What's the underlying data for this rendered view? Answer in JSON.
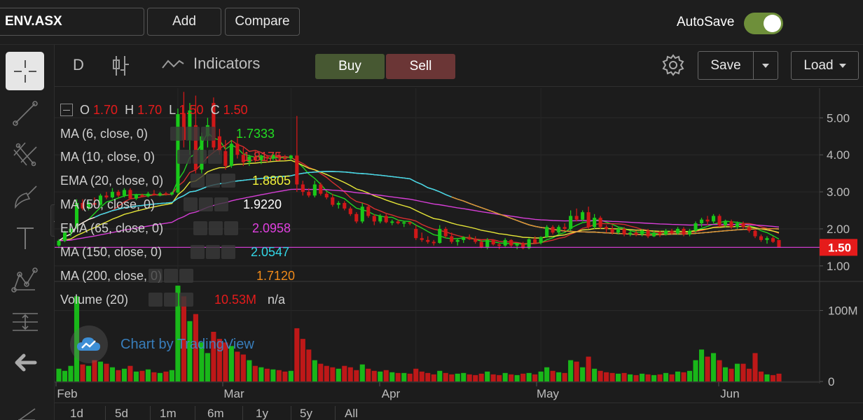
{
  "topbar": {
    "symbol": "ENV.ASX",
    "add_label": "Add",
    "compare_label": "Compare",
    "autosave_label": "AutoSave",
    "autosave_on": true,
    "toggle_color": "#6e8f3a"
  },
  "toolbar": {
    "interval": "D",
    "indicators_label": "Indicators",
    "buy_label": "Buy",
    "sell_label": "Sell",
    "save_label": "Save",
    "load_label": "Load",
    "buy_color": "#475832",
    "sell_color": "#6b3636"
  },
  "left_tools": [
    "crosshair-icon",
    "trend-line-icon",
    "fib-tools-icon",
    "brush-icon",
    "text-icon",
    "pattern-icon",
    "measure-icon",
    "back-arrow-icon"
  ],
  "legend": {
    "ohlc": {
      "o_label": "O",
      "o": "1.70",
      "h_label": "H",
      "h": "1.70",
      "l_label": "L",
      "l": "1.50",
      "c_label": "C",
      "c": "1.50"
    },
    "indicators": [
      {
        "label": "MA (6, close, 0)",
        "value": "1.7333",
        "color": "#22dd22"
      },
      {
        "label": "MA (10, close, 0)",
        "value": "1.8175",
        "color": "#e03030"
      },
      {
        "label": "EMA (20, close, 0)",
        "value": "1.8805",
        "color": "#f2f23a"
      },
      {
        "label": "MA (50, close, 0)",
        "value": "1.9220",
        "color": "#ffffff"
      },
      {
        "label": "EMA (65, close, 0)",
        "value": "2.0958",
        "color": "#e040e0"
      },
      {
        "label": "MA (150, close, 0)",
        "value": "2.0547",
        "color": "#33d6e6"
      },
      {
        "label": "MA (200, close, 0)",
        "value": "1.7120",
        "color": "#f08a1a"
      }
    ],
    "volume": {
      "label": "Volume (20)",
      "value": "10.53M",
      "ma": "n/a"
    }
  },
  "price_axis": {
    "ticks": [
      "5.00",
      "4.00",
      "3.00",
      "2.00",
      "1.00"
    ],
    "last_price": "1.50",
    "last_price_color": "#e51b1b"
  },
  "volume_axis": {
    "ticks": [
      "100M",
      "0"
    ]
  },
  "time_axis": {
    "labels": [
      "Feb",
      "Mar",
      "Apr",
      "May",
      "Jun"
    ]
  },
  "watermark": "Chart by TradingView",
  "ranges": [
    "1d",
    "5d",
    "1m",
    "6m",
    "1y",
    "5y",
    "All"
  ],
  "chart_data": {
    "type": "candlestick",
    "symbol": "ENV.ASX",
    "interval": "D",
    "y_range": [
      0.6,
      5.8
    ],
    "volume_range_millions": [
      0,
      140
    ],
    "candles": [
      {
        "o": 1.55,
        "h": 1.72,
        "l": 1.48,
        "c": 1.68,
        "v": 18
      },
      {
        "o": 1.68,
        "h": 1.95,
        "l": 1.64,
        "c": 1.9,
        "v": 15
      },
      {
        "o": 1.9,
        "h": 2.05,
        "l": 1.8,
        "c": 2.0,
        "v": 22
      },
      {
        "o": 2.05,
        "h": 2.8,
        "l": 2.0,
        "c": 2.7,
        "v": 120
      },
      {
        "o": 2.7,
        "h": 2.8,
        "l": 2.5,
        "c": 2.55,
        "v": 24
      },
      {
        "o": 2.55,
        "h": 2.75,
        "l": 2.5,
        "c": 2.7,
        "v": 22
      },
      {
        "o": 2.7,
        "h": 2.85,
        "l": 2.6,
        "c": 2.65,
        "v": 30
      },
      {
        "o": 2.65,
        "h": 2.95,
        "l": 2.62,
        "c": 2.9,
        "v": 28
      },
      {
        "o": 2.9,
        "h": 3.0,
        "l": 2.8,
        "c": 2.85,
        "v": 25
      },
      {
        "o": 2.85,
        "h": 3.1,
        "l": 2.82,
        "c": 3.0,
        "v": 20
      },
      {
        "o": 3.0,
        "h": 3.05,
        "l": 2.85,
        "c": 2.9,
        "v": 16
      },
      {
        "o": 2.9,
        "h": 3.1,
        "l": 2.85,
        "c": 3.05,
        "v": 18
      },
      {
        "o": 3.05,
        "h": 3.1,
        "l": 2.8,
        "c": 2.82,
        "v": 22
      },
      {
        "o": 2.82,
        "h": 2.95,
        "l": 2.78,
        "c": 2.92,
        "v": 14
      },
      {
        "o": 2.92,
        "h": 2.95,
        "l": 2.85,
        "c": 2.88,
        "v": 15
      },
      {
        "o": 2.88,
        "h": 3.0,
        "l": 2.85,
        "c": 2.95,
        "v": 17
      },
      {
        "o": 2.95,
        "h": 3.05,
        "l": 2.9,
        "c": 2.92,
        "v": 13
      },
      {
        "o": 2.92,
        "h": 3.0,
        "l": 2.88,
        "c": 2.96,
        "v": 12
      },
      {
        "o": 2.96,
        "h": 3.0,
        "l": 2.9,
        "c": 2.93,
        "v": 14
      },
      {
        "o": 2.93,
        "h": 3.0,
        "l": 2.9,
        "c": 2.98,
        "v": 16
      },
      {
        "o": 2.98,
        "h": 5.25,
        "l": 2.95,
        "c": 5.1,
        "v": 135
      },
      {
        "o": 5.1,
        "h": 5.7,
        "l": 4.2,
        "c": 4.4,
        "v": 120
      },
      {
        "o": 4.4,
        "h": 5.4,
        "l": 4.0,
        "c": 5.2,
        "v": 85
      },
      {
        "o": 4.8,
        "h": 5.6,
        "l": 3.5,
        "c": 3.6,
        "v": 95
      },
      {
        "o": 3.6,
        "h": 4.6,
        "l": 3.5,
        "c": 4.5,
        "v": 55
      },
      {
        "o": 4.5,
        "h": 5.0,
        "l": 4.2,
        "c": 4.8,
        "v": 40
      },
      {
        "o": 5.4,
        "h": 5.55,
        "l": 4.1,
        "c": 4.2,
        "v": 70
      },
      {
        "o": 4.5,
        "h": 4.7,
        "l": 4.0,
        "c": 4.1,
        "v": 60
      },
      {
        "o": 4.1,
        "h": 4.4,
        "l": 3.6,
        "c": 3.7,
        "v": 55
      },
      {
        "o": 3.7,
        "h": 4.4,
        "l": 3.65,
        "c": 4.3,
        "v": 50
      },
      {
        "o": 4.3,
        "h": 4.5,
        "l": 3.9,
        "c": 4.0,
        "v": 42
      },
      {
        "o": 4.0,
        "h": 4.2,
        "l": 3.7,
        "c": 3.8,
        "v": 38
      },
      {
        "o": 3.8,
        "h": 4.0,
        "l": 3.7,
        "c": 3.95,
        "v": 30
      },
      {
        "o": 3.95,
        "h": 4.1,
        "l": 3.8,
        "c": 3.85,
        "v": 22
      },
      {
        "o": 3.85,
        "h": 4.0,
        "l": 3.75,
        "c": 3.95,
        "v": 20
      },
      {
        "o": 3.95,
        "h": 4.0,
        "l": 3.8,
        "c": 3.9,
        "v": 18
      },
      {
        "o": 3.9,
        "h": 4.05,
        "l": 3.85,
        "c": 4.0,
        "v": 17
      },
      {
        "o": 4.0,
        "h": 4.05,
        "l": 3.85,
        "c": 3.92,
        "v": 16
      },
      {
        "o": 3.92,
        "h": 4.0,
        "l": 3.85,
        "c": 3.9,
        "v": 14
      },
      {
        "o": 3.9,
        "h": 4.0,
        "l": 3.85,
        "c": 3.98,
        "v": 15
      },
      {
        "o": 3.98,
        "h": 5.05,
        "l": 3.0,
        "c": 3.2,
        "v": 75
      },
      {
        "o": 3.2,
        "h": 3.3,
        "l": 2.9,
        "c": 3.0,
        "v": 60
      },
      {
        "o": 3.0,
        "h": 3.1,
        "l": 2.85,
        "c": 2.9,
        "v": 45
      },
      {
        "o": 2.9,
        "h": 3.3,
        "l": 2.85,
        "c": 3.2,
        "v": 30
      },
      {
        "o": 3.2,
        "h": 3.25,
        "l": 2.9,
        "c": 2.95,
        "v": 25
      },
      {
        "o": 2.95,
        "h": 3.0,
        "l": 2.8,
        "c": 2.85,
        "v": 22
      },
      {
        "o": 2.85,
        "h": 2.95,
        "l": 2.6,
        "c": 2.65,
        "v": 20
      },
      {
        "o": 2.65,
        "h": 2.75,
        "l": 2.55,
        "c": 2.7,
        "v": 18
      },
      {
        "o": 2.7,
        "h": 2.75,
        "l": 2.5,
        "c": 2.55,
        "v": 22
      },
      {
        "o": 2.55,
        "h": 2.6,
        "l": 2.35,
        "c": 2.4,
        "v": 20
      },
      {
        "o": 2.4,
        "h": 2.45,
        "l": 2.15,
        "c": 2.2,
        "v": 16
      },
      {
        "o": 2.2,
        "h": 2.7,
        "l": 2.15,
        "c": 2.6,
        "v": 24
      },
      {
        "o": 2.6,
        "h": 2.65,
        "l": 2.3,
        "c": 2.35,
        "v": 18
      },
      {
        "o": 2.35,
        "h": 2.4,
        "l": 2.1,
        "c": 2.2,
        "v": 15
      },
      {
        "o": 2.2,
        "h": 2.4,
        "l": 2.15,
        "c": 2.35,
        "v": 14
      },
      {
        "o": 2.35,
        "h": 2.4,
        "l": 2.15,
        "c": 2.18,
        "v": 16
      },
      {
        "o": 2.18,
        "h": 2.25,
        "l": 2.1,
        "c": 2.2,
        "v": 13
      },
      {
        "o": 2.2,
        "h": 2.25,
        "l": 2.12,
        "c": 2.15,
        "v": 12
      },
      {
        "o": 2.15,
        "h": 2.2,
        "l": 2.05,
        "c": 2.18,
        "v": 12
      },
      {
        "o": 2.18,
        "h": 2.2,
        "l": 2.1,
        "c": 2.15,
        "v": 11
      },
      {
        "o": 2.0,
        "h": 2.1,
        "l": 1.7,
        "c": 1.75,
        "v": 18
      },
      {
        "o": 1.75,
        "h": 1.9,
        "l": 1.65,
        "c": 1.7,
        "v": 14
      },
      {
        "o": 1.7,
        "h": 1.8,
        "l": 1.6,
        "c": 1.65,
        "v": 12
      },
      {
        "o": 1.65,
        "h": 1.7,
        "l": 1.55,
        "c": 1.62,
        "v": 10
      },
      {
        "o": 1.62,
        "h": 2.1,
        "l": 1.6,
        "c": 2.0,
        "v": 15
      },
      {
        "o": 2.0,
        "h": 2.05,
        "l": 1.75,
        "c": 1.8,
        "v": 12
      },
      {
        "o": 1.8,
        "h": 1.9,
        "l": 1.6,
        "c": 1.65,
        "v": 10
      },
      {
        "o": 1.65,
        "h": 1.75,
        "l": 1.55,
        "c": 1.7,
        "v": 11
      },
      {
        "o": 1.7,
        "h": 1.8,
        "l": 1.62,
        "c": 1.78,
        "v": 12
      },
      {
        "o": 1.78,
        "h": 1.85,
        "l": 1.7,
        "c": 1.72,
        "v": 10
      },
      {
        "o": 1.72,
        "h": 1.8,
        "l": 1.6,
        "c": 1.65,
        "v": 9
      },
      {
        "o": 1.65,
        "h": 1.7,
        "l": 1.48,
        "c": 1.5,
        "v": 11
      },
      {
        "o": 1.5,
        "h": 1.75,
        "l": 1.45,
        "c": 1.7,
        "v": 14
      },
      {
        "o": 1.7,
        "h": 1.72,
        "l": 1.55,
        "c": 1.58,
        "v": 10
      },
      {
        "o": 1.58,
        "h": 1.62,
        "l": 1.45,
        "c": 1.55,
        "v": 9
      },
      {
        "o": 1.55,
        "h": 1.75,
        "l": 1.52,
        "c": 1.7,
        "v": 12
      },
      {
        "o": 1.7,
        "h": 1.72,
        "l": 1.5,
        "c": 1.55,
        "v": 10
      },
      {
        "o": 1.55,
        "h": 1.62,
        "l": 1.45,
        "c": 1.6,
        "v": 9
      },
      {
        "o": 1.6,
        "h": 1.65,
        "l": 1.45,
        "c": 1.48,
        "v": 11
      },
      {
        "o": 1.48,
        "h": 1.75,
        "l": 1.45,
        "c": 1.72,
        "v": 12
      },
      {
        "o": 1.72,
        "h": 1.8,
        "l": 1.6,
        "c": 1.62,
        "v": 10
      },
      {
        "o": 1.62,
        "h": 1.8,
        "l": 1.58,
        "c": 1.78,
        "v": 14
      },
      {
        "o": 1.78,
        "h": 2.1,
        "l": 1.75,
        "c": 2.05,
        "v": 20
      },
      {
        "o": 2.05,
        "h": 2.1,
        "l": 1.85,
        "c": 1.9,
        "v": 15
      },
      {
        "o": 1.9,
        "h": 2.1,
        "l": 1.85,
        "c": 2.05,
        "v": 13
      },
      {
        "o": 2.05,
        "h": 2.15,
        "l": 1.95,
        "c": 2.0,
        "v": 12
      },
      {
        "o": 2.0,
        "h": 2.5,
        "l": 1.95,
        "c": 2.35,
        "v": 30
      },
      {
        "o": 2.35,
        "h": 2.55,
        "l": 2.2,
        "c": 2.25,
        "v": 28
      },
      {
        "o": 2.25,
        "h": 2.5,
        "l": 2.2,
        "c": 2.45,
        "v": 20
      },
      {
        "o": 2.45,
        "h": 2.6,
        "l": 2.0,
        "c": 2.05,
        "v": 35
      },
      {
        "o": 2.05,
        "h": 2.4,
        "l": 2.0,
        "c": 2.3,
        "v": 18
      },
      {
        "o": 2.3,
        "h": 2.35,
        "l": 2.0,
        "c": 2.05,
        "v": 15
      },
      {
        "o": 2.05,
        "h": 2.1,
        "l": 1.9,
        "c": 2.0,
        "v": 13
      },
      {
        "o": 2.0,
        "h": 2.1,
        "l": 1.85,
        "c": 1.9,
        "v": 12
      },
      {
        "o": 1.9,
        "h": 2.05,
        "l": 1.85,
        "c": 2.0,
        "v": 11
      },
      {
        "o": 2.0,
        "h": 2.05,
        "l": 1.8,
        "c": 1.85,
        "v": 12
      },
      {
        "o": 1.85,
        "h": 1.95,
        "l": 1.8,
        "c": 1.9,
        "v": 10
      },
      {
        "o": 1.9,
        "h": 1.95,
        "l": 1.8,
        "c": 1.85,
        "v": 9
      },
      {
        "o": 1.85,
        "h": 2.0,
        "l": 1.8,
        "c": 1.95,
        "v": 11
      },
      {
        "o": 1.95,
        "h": 2.0,
        "l": 1.75,
        "c": 1.8,
        "v": 10
      },
      {
        "o": 1.8,
        "h": 1.95,
        "l": 1.78,
        "c": 1.9,
        "v": 9
      },
      {
        "o": 1.9,
        "h": 1.95,
        "l": 1.78,
        "c": 1.85,
        "v": 10
      },
      {
        "o": 1.85,
        "h": 2.0,
        "l": 1.82,
        "c": 1.95,
        "v": 12
      },
      {
        "o": 1.95,
        "h": 2.0,
        "l": 1.85,
        "c": 1.88,
        "v": 10
      },
      {
        "o": 1.88,
        "h": 2.05,
        "l": 1.85,
        "c": 2.0,
        "v": 14
      },
      {
        "o": 2.0,
        "h": 2.05,
        "l": 1.8,
        "c": 1.85,
        "v": 13
      },
      {
        "o": 1.85,
        "h": 2.0,
        "l": 1.8,
        "c": 1.95,
        "v": 15
      },
      {
        "o": 1.95,
        "h": 2.2,
        "l": 1.9,
        "c": 2.15,
        "v": 30
      },
      {
        "o": 2.15,
        "h": 2.3,
        "l": 2.05,
        "c": 2.25,
        "v": 45
      },
      {
        "o": 2.25,
        "h": 2.35,
        "l": 2.1,
        "c": 2.2,
        "v": 35
      },
      {
        "o": 2.2,
        "h": 2.4,
        "l": 2.15,
        "c": 2.35,
        "v": 40
      },
      {
        "o": 2.35,
        "h": 2.4,
        "l": 2.05,
        "c": 2.1,
        "v": 30
      },
      {
        "o": 2.1,
        "h": 2.25,
        "l": 2.05,
        "c": 2.2,
        "v": 20
      },
      {
        "o": 2.2,
        "h": 2.25,
        "l": 2.0,
        "c": 2.05,
        "v": 18
      },
      {
        "o": 2.05,
        "h": 2.2,
        "l": 2.0,
        "c": 2.15,
        "v": 25
      },
      {
        "o": 2.15,
        "h": 2.2,
        "l": 2.0,
        "c": 2.05,
        "v": 25
      },
      {
        "o": 2.05,
        "h": 2.1,
        "l": 1.9,
        "c": 1.95,
        "v": 18
      },
      {
        "o": 1.95,
        "h": 2.0,
        "l": 1.75,
        "c": 1.8,
        "v": 40
      },
      {
        "o": 1.8,
        "h": 1.85,
        "l": 1.65,
        "c": 1.7,
        "v": 14
      },
      {
        "o": 1.7,
        "h": 1.8,
        "l": 1.6,
        "c": 1.75,
        "v": 10
      },
      {
        "o": 1.75,
        "h": 1.8,
        "l": 1.62,
        "c": 1.65,
        "v": 9
      },
      {
        "o": 1.7,
        "h": 1.7,
        "l": 1.5,
        "c": 1.5,
        "v": 11
      }
    ],
    "moving_averages": [
      {
        "name": "MA (6, close, 0)",
        "color": "#22dd22",
        "period": 6,
        "kind": "sma"
      },
      {
        "name": "MA (10, close, 0)",
        "color": "#e03030",
        "period": 10,
        "kind": "sma"
      },
      {
        "name": "EMA (20, close, 0)",
        "color": "#f2f23a",
        "period": 20,
        "kind": "ema"
      },
      {
        "name": "MA (50, close, 0)",
        "color": "#ffffff",
        "period": 50,
        "kind": "sma"
      },
      {
        "name": "EMA (65, close, 0)",
        "color": "#e040e0",
        "period": 65,
        "kind": "ema"
      },
      {
        "name": "MA (150, close, 0)",
        "color": "#33d6e6",
        "period": 150,
        "kind": "sma"
      },
      {
        "name": "MA (200, close, 0)",
        "color": "#f08a1a",
        "period": 200,
        "kind": "sma"
      }
    ],
    "up_color": "#19c919",
    "down_color": "#d01818"
  }
}
